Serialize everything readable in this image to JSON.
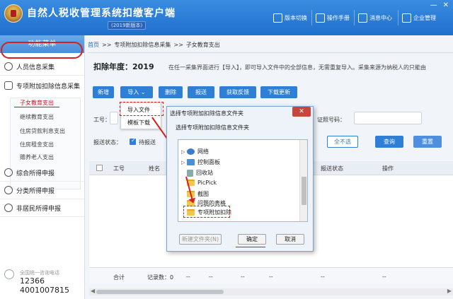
{
  "header": {
    "title": "自然人税收管理系统扣缴客户端",
    "subtitle": "(2019新版本)",
    "buttons": [
      "版本切换",
      "操作手册",
      "消息中心",
      "企业管理"
    ]
  },
  "sidebar": {
    "heading": "功能菜单",
    "items": [
      "人员信息采集",
      "专项附加扣除信息采集",
      "综合所得申报",
      "分类所得申报",
      "非居民所得申报"
    ],
    "sub_items": [
      "子女教育支出",
      "继续教育支出",
      "住房贷款利息支出",
      "住房租金支出",
      "赡养老人支出"
    ],
    "hotline_label": "全国统一咨询电话",
    "hotline_1": "12366",
    "hotline_2": "4001007815"
  },
  "breadcrumb": {
    "home": "首页",
    "sep": ">>",
    "items": [
      "专项附加扣除信息采集",
      "子女教育支出"
    ]
  },
  "year": {
    "label": "扣除年度：2019",
    "hint": "在任一采集界面进行【导入】，即可导入文件中的全部信息，无需重复导入。采集来源为纳税人的只能由"
  },
  "toolbar": {
    "add": "新增",
    "import": "导入",
    "delete": "删除",
    "report": "报送",
    "feedback": "获取反馈",
    "download": "下载更新"
  },
  "import_menu": {
    "import_file": "导入文件",
    "template": "模板下载"
  },
  "filters": {
    "work_no_label": "工号：",
    "id_no_label": "证照号码：",
    "status_label": "报送状态：",
    "pending_label": "待报送",
    "select_none": "全不选",
    "query": "查询",
    "reset": "重置"
  },
  "table": {
    "headers": [
      "工号",
      "姓名",
      "报送状态",
      "操作"
    ],
    "footer_total": "合计",
    "footer_records": "记录数：0",
    "dash": "--"
  },
  "dialog": {
    "title": "选择专项附加扣除信息文件夹",
    "message": "选择专项附加扣除信息文件夹",
    "close": "✕",
    "tree": [
      "网络",
      "控制面板",
      "回收站",
      "PicPick",
      "截图",
      "问题的表格",
      "专项附加扣除"
    ],
    "new_folder": "新建文件夹(N)",
    "ok": "确定",
    "cancel": "取消"
  }
}
